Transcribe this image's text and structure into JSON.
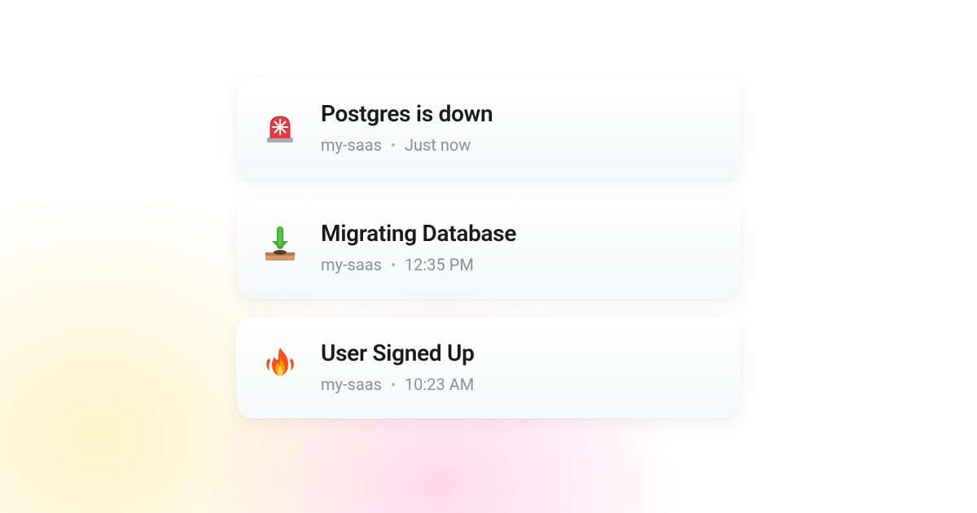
{
  "notifications": [
    {
      "icon": "siren-icon",
      "title": "Postgres is down",
      "project": "my-saas",
      "time": "Just now"
    },
    {
      "icon": "download-tray-icon",
      "title": "Migrating Database",
      "project": "my-saas",
      "time": "12:35 PM"
    },
    {
      "icon": "fire-icon",
      "title": "User Signed Up",
      "project": "my-saas",
      "time": "10:23 AM"
    }
  ]
}
